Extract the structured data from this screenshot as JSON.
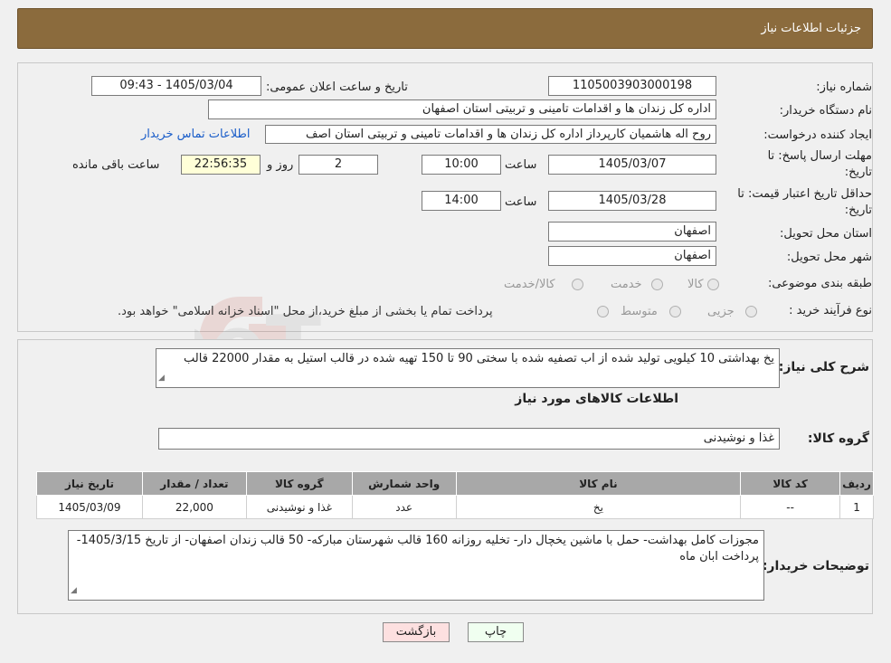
{
  "header": {
    "title": "جزئیات اطلاعات نیاز"
  },
  "fields": {
    "need_number_label": "شماره نیاز:",
    "need_number": "1105003903000198",
    "announce_label": "تاریخ و ساعت اعلان عمومی:",
    "announce_value": "1405/03/04 - 09:43",
    "buyer_org_label": "نام دستگاه خریدار:",
    "buyer_org": "اداره کل زندان ها و اقدامات تامینی و تربیتی استان اصفهان",
    "creator_label": "ایجاد کننده درخواست:",
    "creator": "روح اله هاشمیان کارپرداز اداره کل زندان ها و اقدامات تامینی و تربیتی استان اصف",
    "contact_link": "اطلاعات تماس خریدار",
    "deadline_label_1": "مهلت ارسال پاسخ: تا",
    "deadline_label_2": "تاریخ:",
    "deadline_date": "1405/03/07",
    "hour_label": "ساعت",
    "deadline_time": "10:00",
    "days_value": "2",
    "days_label": "روز و",
    "remaining_time": "22:56:35",
    "remaining_label": "ساعت باقی مانده",
    "validity_label_1": "حداقل تاریخ اعتبار قیمت: تا",
    "validity_label_2": "تاریخ:",
    "validity_date": "1405/03/28",
    "validity_time": "14:00",
    "province_label": "استان محل تحویل:",
    "province": "اصفهان",
    "city_label": "شهر محل تحویل:",
    "city": "اصفهان",
    "category_label": "طبقه بندی موضوعی:",
    "category_options": [
      "کالا",
      "خدمت",
      "کالا/خدمت"
    ],
    "process_label": "نوع فرآیند خرید :",
    "process_options": [
      "جزیی",
      "متوسط"
    ],
    "process_note": "پرداخت تمام یا بخشی از مبلغ خرید،از محل \"اسناد خزانه اسلامی\" خواهد بود."
  },
  "details": {
    "summary_label": "شرح کلی نیاز:",
    "summary_text": "یخ بهداشتی 10 کیلویی تولید شده از اب تصفیه شده با سختی 90 تا 150 تهیه شده در قالب استیل به مقدار 22000 قالب",
    "goods_info_title": "اطلاعات کالاهای مورد نیاز",
    "goods_group_label": "گروه کالا:",
    "goods_group": "غذا و نوشیدنی",
    "table": {
      "headers": [
        "ردیف",
        "کد کالا",
        "نام کالا",
        "واحد شمارش",
        "گروه کالا",
        "تعداد / مقدار",
        "تاریخ نیاز"
      ],
      "rows": [
        [
          "1",
          "--",
          "یخ",
          "عدد",
          "غذا و نوشیدنی",
          "22,000",
          "1405/03/09"
        ]
      ]
    },
    "buyer_notes_label": "توضیحات خریدار:",
    "buyer_notes": "مجوزات کامل بهداشت- حمل با ماشین یخچال دار- تخلیه روزانه 160 قالب شهرستان مبارکه- 50 قالب زندان اصفهان- از تاریخ 1405/3/15- پرداخت ابان ماه"
  },
  "buttons": {
    "print": "چاپ",
    "back": "بازگشت"
  },
  "colors": {
    "header_bg": "#8b6b3d",
    "link": "#1a5dc9",
    "back_button_bg": "#fde0e0",
    "print_button_bg": "#f0fff0"
  }
}
